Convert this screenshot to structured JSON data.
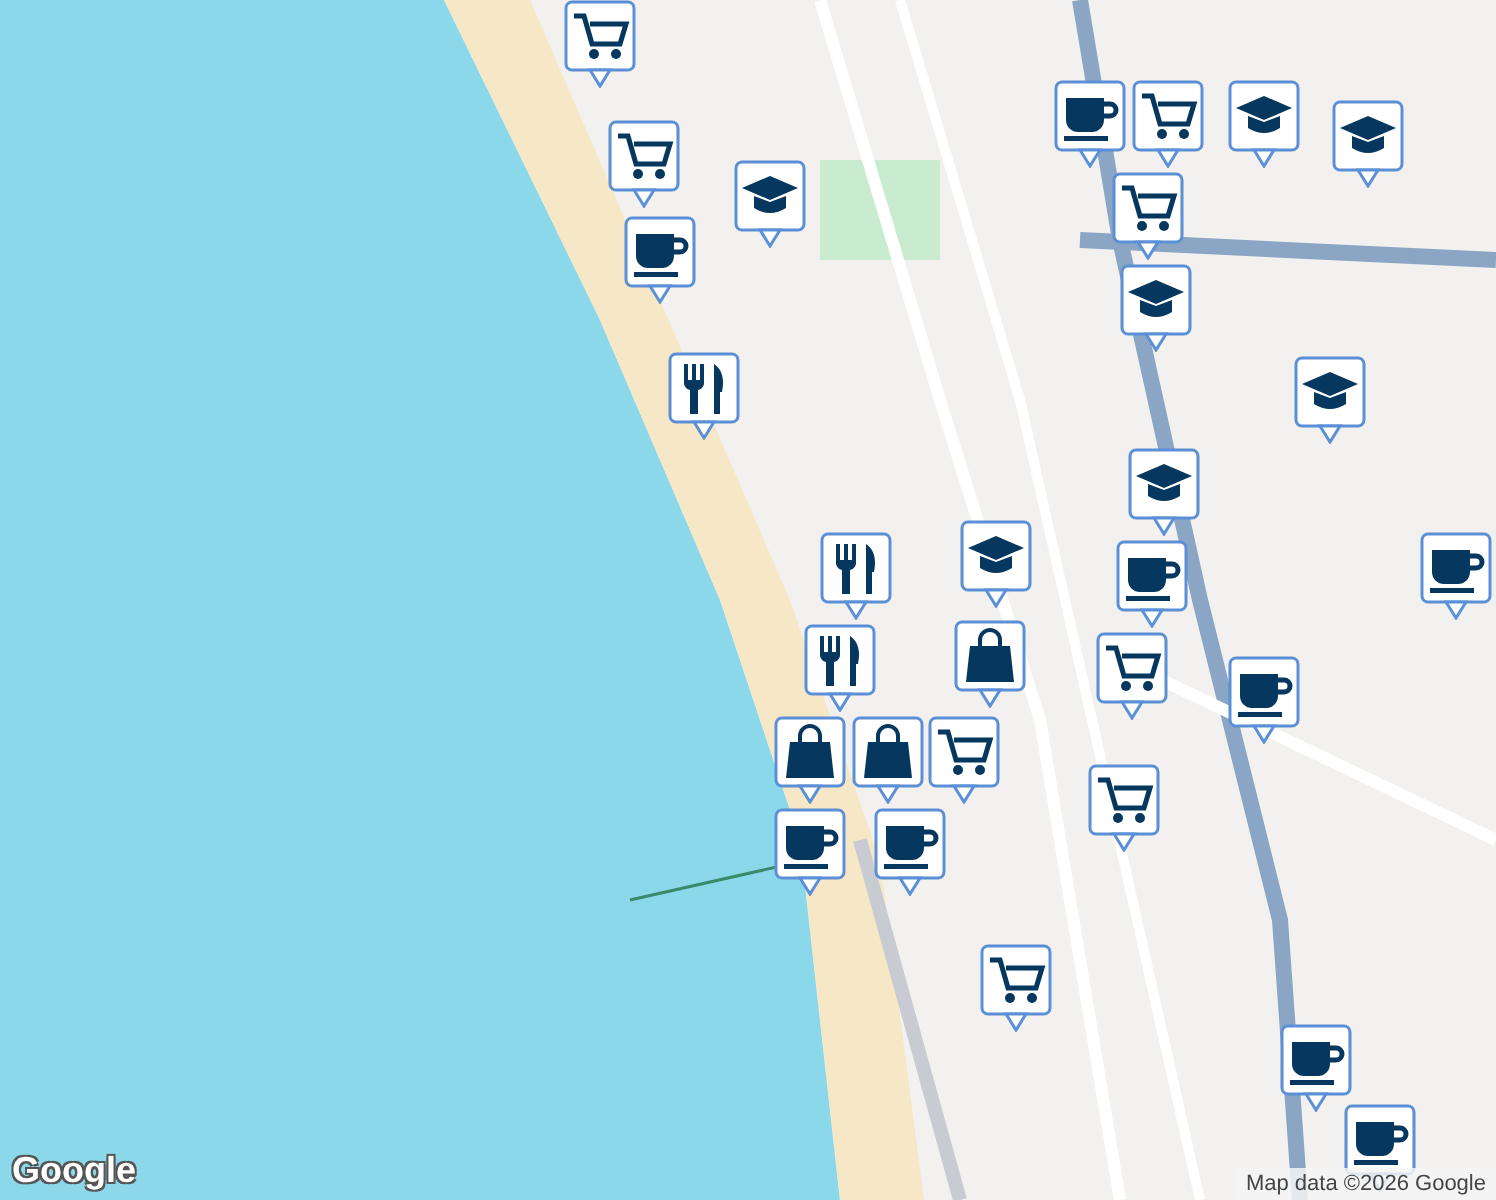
{
  "map": {
    "markers": [
      {
        "kind": "cart"
      },
      {
        "kind": "cart"
      },
      {
        "kind": "coffee"
      },
      {
        "kind": "school"
      },
      {
        "kind": "food"
      },
      {
        "kind": "food"
      },
      {
        "kind": "school"
      },
      {
        "kind": "bag"
      },
      {
        "kind": "food"
      },
      {
        "kind": "bag"
      },
      {
        "kind": "cart"
      },
      {
        "kind": "bag"
      },
      {
        "kind": "coffee"
      },
      {
        "kind": "coffee"
      },
      {
        "kind": "cart"
      },
      {
        "kind": "cart"
      },
      {
        "kind": "coffee"
      },
      {
        "kind": "school"
      },
      {
        "kind": "coffee"
      },
      {
        "kind": "cart"
      },
      {
        "kind": "coffee"
      },
      {
        "kind": "coffee"
      },
      {
        "kind": "school"
      },
      {
        "kind": "school"
      },
      {
        "kind": "cart"
      },
      {
        "kind": "cart"
      },
      {
        "kind": "school"
      },
      {
        "kind": "school"
      },
      {
        "kind": "coffee"
      },
      {
        "kind": "coffee"
      }
    ]
  },
  "logo": "Google",
  "attribution": "Map data ©2026 Google"
}
